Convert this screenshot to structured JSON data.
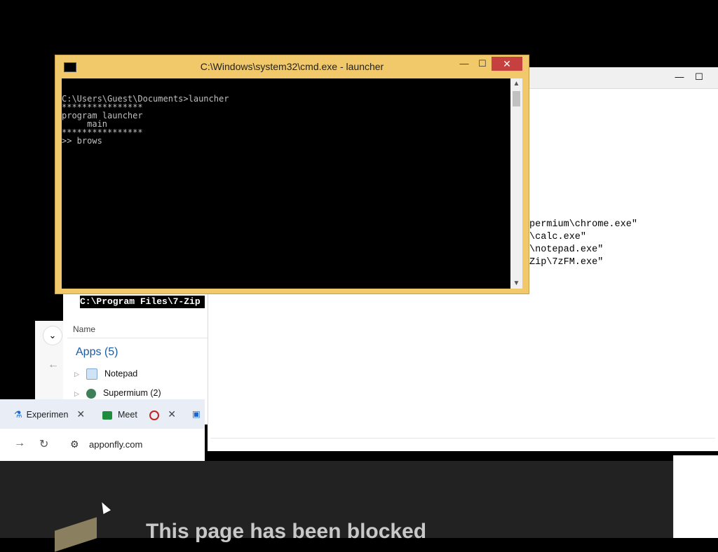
{
  "notepad": {
    "title": "",
    "buttons": {
      "minimize": "—",
      "maximize": "☐"
    },
    "lines": [
      "permium\\chrome.exe\"",
      "\\calc.exe\"",
      "\\notepad.exe\"",
      "Zip\\7zFM.exe\""
    ]
  },
  "explorer": {
    "path": "C:\\Program Files\\7-Zip",
    "column": "Name",
    "group": "Apps (5)",
    "items": [
      {
        "label": "Notepad"
      },
      {
        "label": "Supermium (2)"
      }
    ]
  },
  "browser": {
    "tabs": [
      {
        "label": "Experimen",
        "icon": "flask-icon"
      },
      {
        "label": "Meet",
        "icon": "meet-icon"
      }
    ],
    "url": "apponfly.com",
    "blocked_heading": "This page has been blocked"
  },
  "cmd": {
    "title": "C:\\Windows\\system32\\cmd.exe - launcher",
    "console_lines": [
      "C:\\Users\\Guest\\Documents>launcher",
      "****************",
      "program launcher",
      "     main",
      "****************",
      ">> brows"
    ]
  },
  "colors": {
    "cmd_frame": "#f1c86a",
    "close_button": "#c74040",
    "link_blue": "#1b5aa6"
  }
}
